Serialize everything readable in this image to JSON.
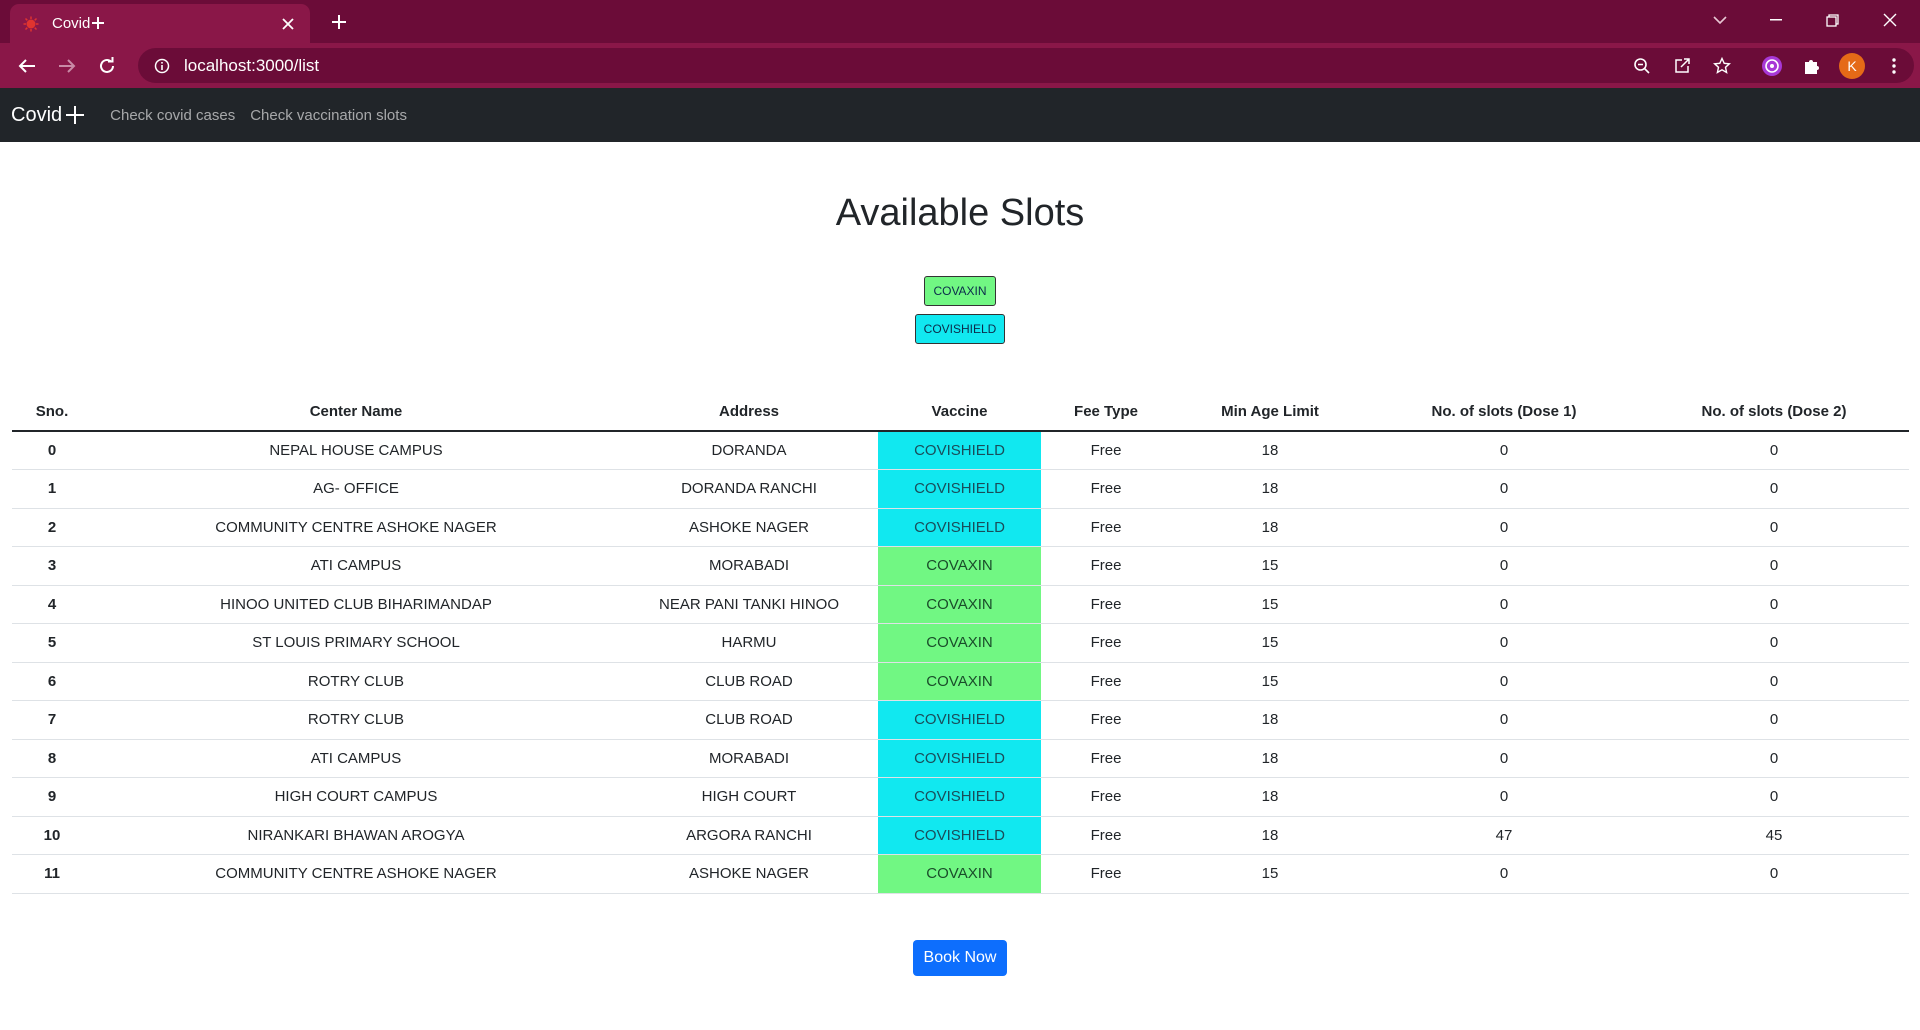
{
  "browser": {
    "tab_title": "Covid",
    "url": "localhost:3000/list",
    "profile_initial": "K"
  },
  "nav": {
    "brand": "Covid",
    "links": [
      "Check covid cases",
      "Check vaccination slots"
    ]
  },
  "page": {
    "title": "Available Slots",
    "filters": [
      "COVAXIN",
      "COVISHIELD"
    ],
    "book_label": "Book Now"
  },
  "table": {
    "headers": [
      "Sno.",
      "Center Name",
      "Address",
      "Vaccine",
      "Fee Type",
      "Min Age Limit",
      "No. of slots (Dose 1)",
      "No. of slots (Dose 2)"
    ],
    "rows": [
      [
        "0",
        "NEPAL HOUSE CAMPUS",
        "DORANDA",
        "COVISHIELD",
        "Free",
        "18",
        "0",
        "0"
      ],
      [
        "1",
        "AG- OFFICE",
        "DORANDA RANCHI",
        "COVISHIELD",
        "Free",
        "18",
        "0",
        "0"
      ],
      [
        "2",
        "COMMUNITY CENTRE ASHOKE NAGER",
        "ASHOKE NAGER",
        "COVISHIELD",
        "Free",
        "18",
        "0",
        "0"
      ],
      [
        "3",
        "ATI CAMPUS",
        "MORABADI",
        "COVAXIN",
        "Free",
        "15",
        "0",
        "0"
      ],
      [
        "4",
        "HINOO UNITED CLUB BIHARIMANDAP",
        "NEAR PANI TANKI HINOO",
        "COVAXIN",
        "Free",
        "15",
        "0",
        "0"
      ],
      [
        "5",
        "ST LOUIS PRIMARY SCHOOL",
        "HARMU",
        "COVAXIN",
        "Free",
        "15",
        "0",
        "0"
      ],
      [
        "6",
        "ROTRY CLUB",
        "CLUB ROAD",
        "COVAXIN",
        "Free",
        "15",
        "0",
        "0"
      ],
      [
        "7",
        "ROTRY CLUB",
        "CLUB ROAD",
        "COVISHIELD",
        "Free",
        "18",
        "0",
        "0"
      ],
      [
        "8",
        "ATI CAMPUS",
        "MORABADI",
        "COVISHIELD",
        "Free",
        "18",
        "0",
        "0"
      ],
      [
        "9",
        "HIGH COURT CAMPUS",
        "HIGH COURT",
        "COVISHIELD",
        "Free",
        "18",
        "0",
        "0"
      ],
      [
        "10",
        "NIRANKARI BHAWAN AROGYA",
        "ARGORA RANCHI",
        "COVISHIELD",
        "Free",
        "18",
        "47",
        "45"
      ],
      [
        "11",
        "COMMUNITY CENTRE ASHOKE NAGER",
        "ASHOKE NAGER",
        "COVAXIN",
        "Free",
        "15",
        "0",
        "0"
      ]
    ]
  },
  "colors": {
    "covaxin": "#71f783",
    "covishield": "#11e8f0",
    "chrome_dark": "#6b0c38",
    "chrome_tab": "#8a1748",
    "primary": "#0d6efd"
  }
}
